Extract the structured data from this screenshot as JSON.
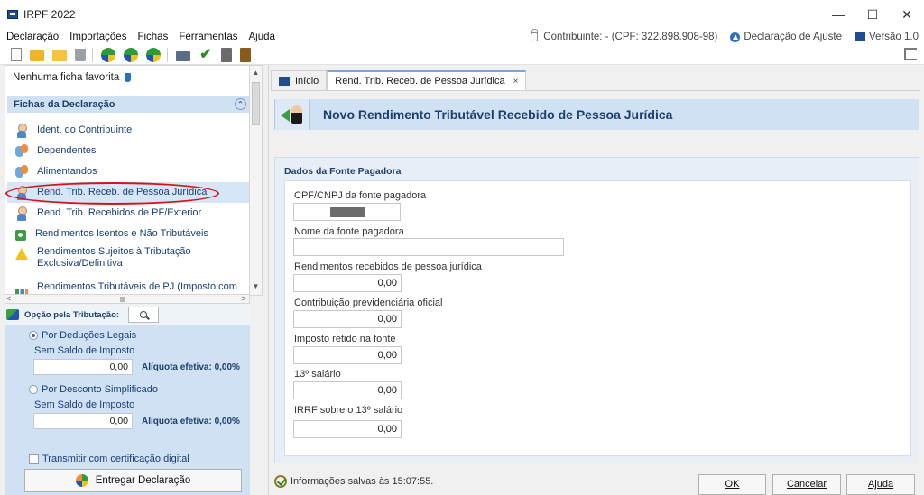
{
  "window": {
    "title": "IRPF 2022",
    "minimize": "—",
    "maximize": "☐",
    "close": "✕"
  },
  "menu": {
    "items": [
      "Declaração",
      "Importações",
      "Fichas",
      "Ferramentas",
      "Ajuda"
    ],
    "contribuinte": "Contribuinte:  - (CPF: 322.898.908-98)",
    "declaracao": "Declaração de Ajuste",
    "versao": "Versão 1.0"
  },
  "sidebar": {
    "favorites": "Nenhuma ficha favorita",
    "header": "Fichas da Declaração",
    "collapse_glyph": "⌃",
    "items": [
      {
        "label": "Ident. do Contribuinte",
        "icon": "person-icon"
      },
      {
        "label": "Dependentes",
        "icon": "group-icon"
      },
      {
        "label": "Alimentandos",
        "icon": "group-icon"
      },
      {
        "label": "Rend. Trib. Receb. de Pessoa Jurídica",
        "icon": "person-arrow-icon",
        "selected": true
      },
      {
        "label": "Rend. Trib. Recebidos de PF/Exterior",
        "icon": "person-arrow-icon"
      },
      {
        "label": "Rendimentos Isentos e Não Tributáveis",
        "icon": "green-doc-icon"
      },
      {
        "label": "Rendimentos Sujeitos à Tributação Exclusiva/Definitiva",
        "icon": "warning-icon"
      },
      {
        "label": "Rendimentos Tributáveis de PJ (Imposto com",
        "icon": "chart-icon"
      }
    ],
    "scroll_up": "▲",
    "scroll_down": "▼",
    "scroll_left": "<",
    "scroll_right": ">"
  },
  "tributacao": {
    "label": "Opção pela Tributação:",
    "deducoes_label": "Por Deduções Legais",
    "deducoes_sub": "Sem Saldo de Imposto",
    "deducoes_value": "0,00",
    "deducoes_aliquota": "Alíquota efetiva: 0,00%",
    "simplificado_label": "Por Desconto Simplificado",
    "simplificado_sub": "Sem Saldo de Imposto",
    "simplificado_value": "0,00",
    "simplificado_aliquota": "Alíquota efetiva: 0,00%",
    "certificacao": "Transmitir com certificação digital",
    "entregar": "Entregar Declaração"
  },
  "tabs": [
    {
      "label": "Início"
    },
    {
      "label": "Rend. Trib. Receb. de Pessoa Jurídica",
      "close": "×"
    }
  ],
  "form": {
    "title": "Novo Rendimento Tributável Recebido de Pessoa Jurídica",
    "section": "Dados da Fonte Pagadora",
    "fields": {
      "cpf_label": "CPF/CNPJ da fonte pagadora",
      "nome_label": "Nome da fonte pagadora",
      "rend_label": "Rendimentos recebidos de pessoa jurídica",
      "rend_value": "0,00",
      "contrib_label": "Contribuição previdenciária oficial",
      "contrib_value": "0,00",
      "imposto_label": "Imposto retido na fonte",
      "imposto_value": "0,00",
      "decimo_label": "13º salário",
      "decimo_value": "0,00",
      "irrf_label": "IRRF sobre o 13º salário",
      "irrf_value": "0,00"
    }
  },
  "status": {
    "saved": "Informações salvas às 15:07:55."
  },
  "buttons": {
    "ok": "OK",
    "cancelar": "Cancelar",
    "ajuda": "Ajuda"
  }
}
